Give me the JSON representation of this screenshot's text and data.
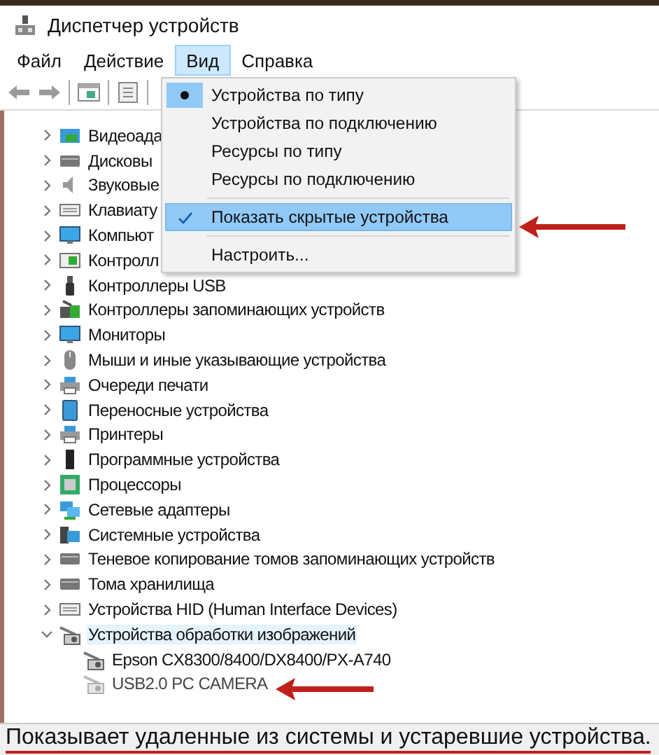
{
  "window": {
    "title": "Диспетчер устройств"
  },
  "menu_bar": [
    {
      "label": "Файл",
      "selected": false
    },
    {
      "label": "Действие",
      "selected": false
    },
    {
      "label": "Вид",
      "selected": true
    },
    {
      "label": "Справка",
      "selected": false
    }
  ],
  "view_menu": [
    {
      "kind": "radio",
      "label": "Устройства по типу",
      "checked": true,
      "highlighted": false
    },
    {
      "kind": "radio",
      "label": "Устройства по подключению",
      "checked": false,
      "highlighted": false
    },
    {
      "kind": "radio",
      "label": "Ресурсы по типу",
      "checked": false,
      "highlighted": false
    },
    {
      "kind": "radio",
      "label": "Ресурсы по подключению",
      "checked": false,
      "highlighted": false
    },
    {
      "kind": "separator"
    },
    {
      "kind": "check",
      "label": "Показать скрытые устройства",
      "checked": true,
      "highlighted": true
    },
    {
      "kind": "separator"
    },
    {
      "kind": "command",
      "label": "Настроить...",
      "highlighted": false
    }
  ],
  "tree": [
    {
      "label": "Видеоада",
      "expanded": false,
      "selected": false
    },
    {
      "label": "Дисковы",
      "expanded": false,
      "selected": false
    },
    {
      "label": "Звуковые",
      "expanded": false,
      "selected": false
    },
    {
      "label": "Клавиату",
      "expanded": false,
      "selected": false
    },
    {
      "label": "Компьют",
      "expanded": false,
      "selected": false
    },
    {
      "label": "Контролл",
      "expanded": false,
      "selected": false
    },
    {
      "label": "Контроллеры USB",
      "expanded": false,
      "selected": false
    },
    {
      "label": "Контроллеры запоминающих устройств",
      "expanded": false,
      "selected": false
    },
    {
      "label": "Мониторы",
      "expanded": false,
      "selected": false
    },
    {
      "label": "Мыши и иные указывающие устройства",
      "expanded": false,
      "selected": false
    },
    {
      "label": "Очереди печати",
      "expanded": false,
      "selected": false
    },
    {
      "label": "Переносные устройства",
      "expanded": false,
      "selected": false
    },
    {
      "label": "Принтеры",
      "expanded": false,
      "selected": false
    },
    {
      "label": "Программные устройства",
      "expanded": false,
      "selected": false
    },
    {
      "label": "Процессоры",
      "expanded": false,
      "selected": false
    },
    {
      "label": "Сетевые адаптеры",
      "expanded": false,
      "selected": false
    },
    {
      "label": "Системные устройства",
      "expanded": false,
      "selected": false
    },
    {
      "label": "Теневое копирование томов запоминающих устройств",
      "expanded": false,
      "selected": false
    },
    {
      "label": "Тома хранилища",
      "expanded": false,
      "selected": false
    },
    {
      "label": "Устройства HID (Human Interface Devices)",
      "expanded": false,
      "selected": false
    },
    {
      "label": "Устройства обработки изображений",
      "expanded": true,
      "selected": true,
      "children": [
        {
          "label": "Epson CX8300/8400/DX8400/PX-A740",
          "hidden": false
        },
        {
          "label": "USB2.0 PC CAMERA",
          "hidden": true
        }
      ]
    }
  ],
  "status_bar": {
    "text": "Показывает удаленные из системы и устаревшие устройства."
  }
}
